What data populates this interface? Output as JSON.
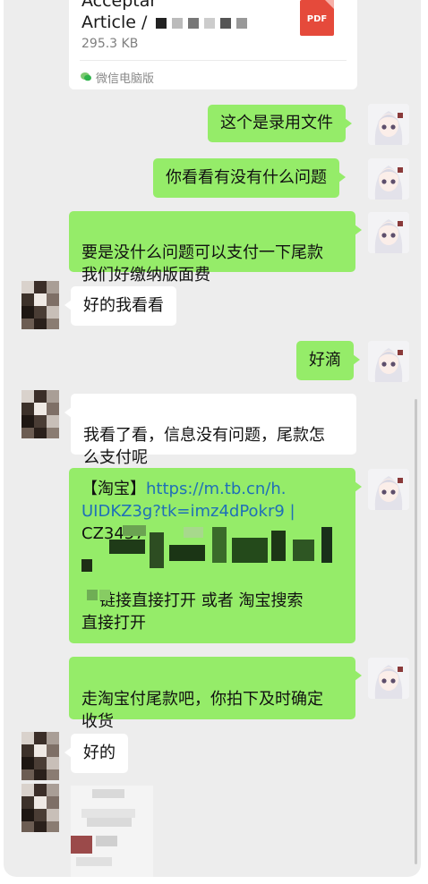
{
  "file_message": {
    "title_line1": "Acceptar",
    "title_line2": "Article /",
    "size": "295.3 KB",
    "type_badge": "PDF",
    "source": "微信电脑版"
  },
  "messages": [
    {
      "side": "out",
      "text": "这个是录用文件"
    },
    {
      "side": "out",
      "text": "你看看有没有什么问题"
    },
    {
      "side": "out",
      "text": "要是没什么问题可以支付一下尾款\n我们好缴纳版面费"
    },
    {
      "side": "in",
      "text": "好的我看看"
    },
    {
      "side": "out",
      "text": "好滴"
    },
    {
      "side": "in",
      "text": "我看了看，信息没有问题，尾款怎\n么支付呢"
    },
    {
      "side": "out",
      "taobao": {
        "tag": "【淘宝】",
        "url_line1": "https://m.tb.cn/h.",
        "url_line2": "UIDKZ3g?tk=imz4dPokr9 |",
        "code": "CZ3457",
        "instruction_line1": "链接直接打开 或者 淘宝搜索",
        "instruction_line2": "直接打开"
      }
    },
    {
      "side": "out",
      "text": "走淘宝付尾款吧，你拍下及时确定\n收货"
    },
    {
      "side": "in",
      "text": "好的"
    }
  ],
  "colors": {
    "outgoing_bubble": "#95ec69",
    "incoming_bubble": "#ffffff",
    "chat_background": "#ededed",
    "link": "#1f6fb8",
    "pdf_badge": "#e54a3b"
  },
  "icons": [
    "pdf-file-icon",
    "wechat-icon",
    "anime-girl-avatar",
    "pixelated-contact-avatar"
  ]
}
